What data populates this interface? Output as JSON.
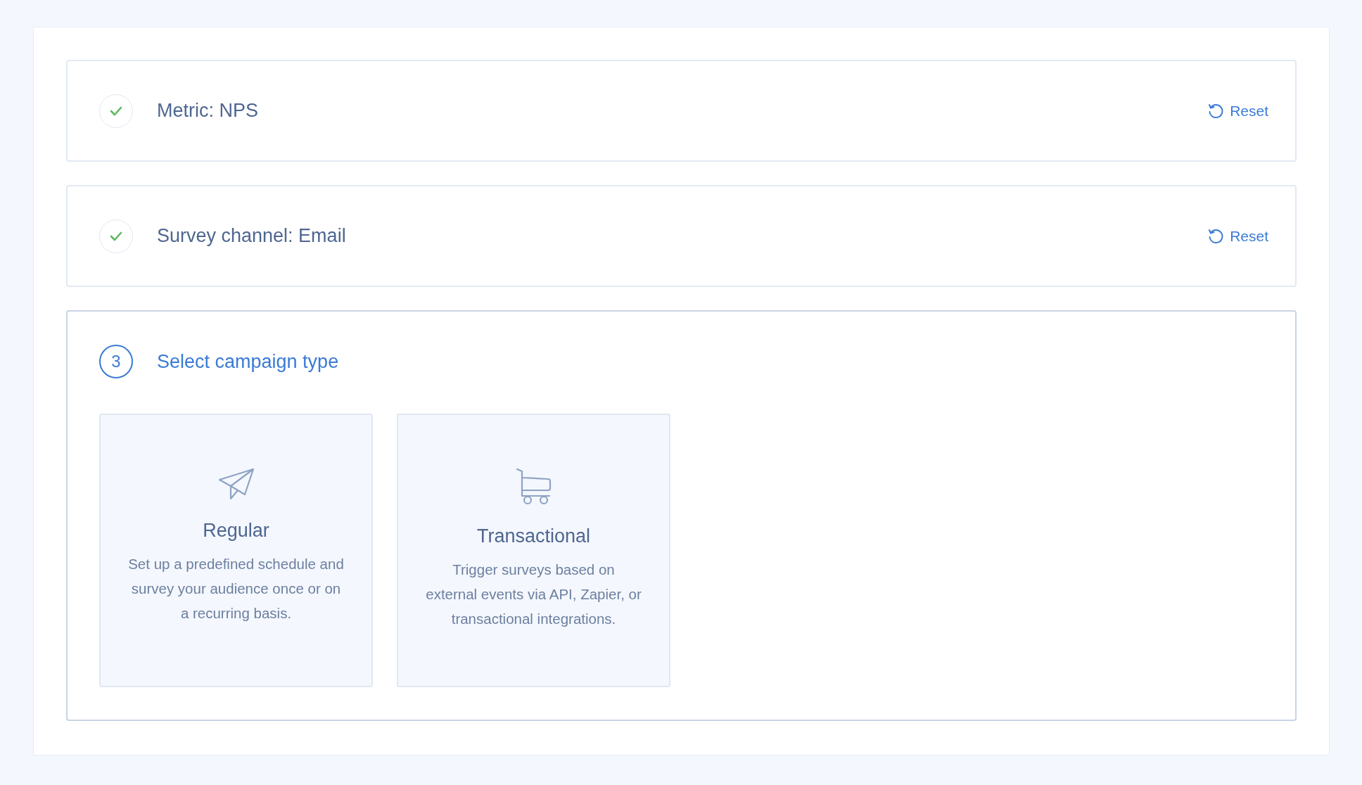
{
  "steps": [
    {
      "kind": "done",
      "title": "Metric: NPS",
      "action": "Reset"
    },
    {
      "kind": "done",
      "title": "Survey channel: Email",
      "action": "Reset"
    },
    {
      "kind": "current",
      "number": "3",
      "title": "Select campaign type",
      "options": [
        {
          "kind": "regular",
          "title": "Regular",
          "description": "Set up a predefined schedule and survey your audience once or on a recurring basis."
        },
        {
          "kind": "transactional",
          "title": "Transactional",
          "description": "Trigger surveys based on external events via API, Zapier, or transactional integrations."
        }
      ]
    }
  ]
}
